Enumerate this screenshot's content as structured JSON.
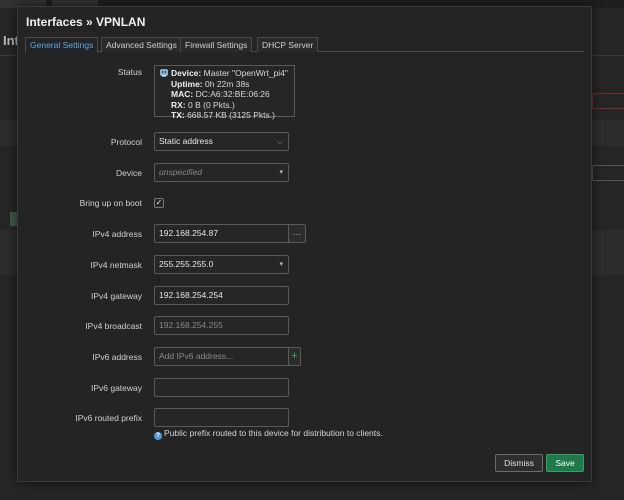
{
  "background": {
    "title": "Int"
  },
  "modal": {
    "title": "Interfaces » VPNLAN",
    "tabs": [
      {
        "label": "General Settings",
        "active": true
      },
      {
        "label": "Advanced Settings",
        "active": false
      },
      {
        "label": "Firewall Settings",
        "active": false
      },
      {
        "label": "DHCP Server",
        "active": false
      }
    ],
    "status": {
      "label": "Status",
      "icon": "network-port-icon",
      "device_key": "Device:",
      "device_value": "Master \"OpenWrt_pi4\"",
      "uptime_key": "Uptime:",
      "uptime_value": "0h 22m 38s",
      "mac_key": "MAC:",
      "mac_value": "DC:A6:32:BE:06:26",
      "rx_key": "RX:",
      "rx_value": "0 B (0 Pkts.)",
      "tx_key": "TX:",
      "tx_value": "668.57 KB (3125 Pkts.)"
    },
    "protocol": {
      "label": "Protocol",
      "value": "Static address"
    },
    "device": {
      "label": "Device",
      "value": "unspecified"
    },
    "boot": {
      "label": "Bring up on boot",
      "checked": true,
      "check_glyph": "✓"
    },
    "ipv4_address": {
      "label": "IPv4 address",
      "value": "192.168.254.87",
      "addon": "…"
    },
    "ipv4_netmask": {
      "label": "IPv4 netmask",
      "value": "255.255.255.0"
    },
    "ipv4_gateway": {
      "label": "IPv4 gateway",
      "value": "192.168.254.254"
    },
    "ipv4_broadcast": {
      "label": "IPv4 broadcast",
      "placeholder": "192.168.254.255"
    },
    "ipv6_address": {
      "label": "IPv6 address",
      "placeholder": "Add IPv6 address...",
      "addon": "+"
    },
    "ipv6_gateway": {
      "label": "IPv6 gateway",
      "value": ""
    },
    "ipv6_prefix": {
      "label": "IPv6 routed prefix",
      "value": "",
      "hint": "Public prefix routed to this device for distribution to clients.",
      "hint_icon": "info-icon"
    },
    "buttons": {
      "dismiss": "Dismiss",
      "save": "Save"
    },
    "colors": {
      "accent_tab": "#5aa9e6",
      "save": "#1f7a4a",
      "info": "#4d9ad5"
    }
  }
}
